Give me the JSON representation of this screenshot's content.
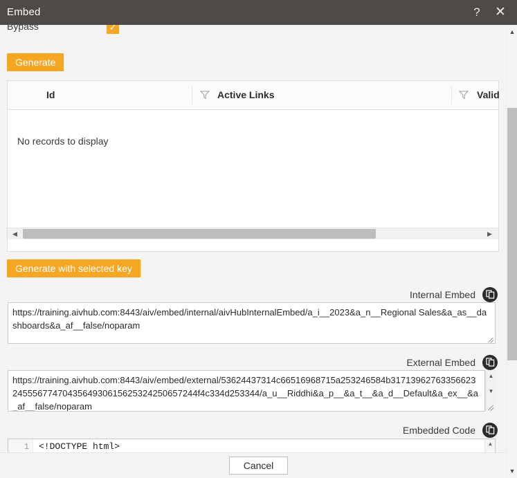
{
  "window": {
    "title": "Embed",
    "help_label": "?",
    "close_label": "✕"
  },
  "form": {
    "bypass_label": "Bypass",
    "bypass_checked_glyph": "✓",
    "generate_label": "Generate",
    "generate_with_key_label": "Generate with selected key"
  },
  "grid": {
    "columns": [
      {
        "label": "Id",
        "filter_icon": "filter-icon"
      },
      {
        "label": "Active Links",
        "filter_icon": "filter-icon"
      },
      {
        "label": "Valid",
        "filter_icon": "filter-icon"
      }
    ],
    "empty_message": "No records to display",
    "hscroll": {
      "left_arrow": "◀",
      "right_arrow": "▶"
    }
  },
  "internal_embed": {
    "label": "Internal Embed",
    "copy_icon": "copy-icon",
    "value": "https://training.aivhub.com:8443/aiv/embed/internal/aivHubInternalEmbed/a_i__2023&a_n__Regional Sales&a_as__dashboards&a_af__false/noparam"
  },
  "external_embed": {
    "label": "External Embed",
    "copy_icon": "copy-icon",
    "value": "https://training.aivhub.com:8443/aiv/embed/external/53624437314c66516968715a253246584b317139627633566232455567747043564930615625324250657244f4c334d253344/a_u__Riddhi&a_p__&a_t__&a_d__Default&a_ex__&a_af__false/noparam",
    "scroll_up": "▲",
    "scroll_down": "▼"
  },
  "embedded_code": {
    "label": "Embedded Code",
    "copy_icon": "copy-icon",
    "line_number": "1",
    "first_line": "<!DOCTYPE html>",
    "scroll_up": "▲"
  },
  "footer": {
    "cancel_label": "Cancel"
  },
  "main_scrollbar": {
    "up_arrow": "▲",
    "down_arrow": "▼"
  },
  "colors": {
    "titlebar": "#4d4a48",
    "accent_orange": "#f5a623",
    "panel_bg": "#f4f4f4",
    "field_bg": "#ffffff",
    "scroll_thumb": "#bdbdbd"
  }
}
